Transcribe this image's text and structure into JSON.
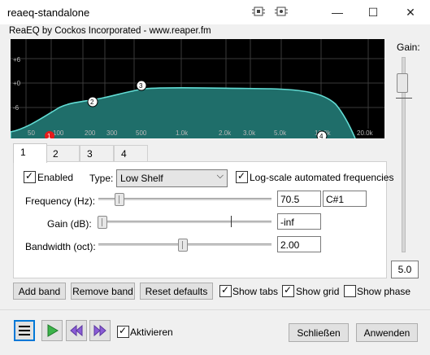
{
  "window": {
    "title": "reaeq-standalone",
    "minimize": "—",
    "maximize": "☐",
    "close": "✕"
  },
  "plugin": {
    "info": "ReaEQ by Cockos Incorporated - www.reaper.fm"
  },
  "graph": {
    "db_labels": [
      "+6",
      "+0",
      "-6"
    ],
    "freq_labels": [
      "50",
      "100",
      "200",
      "300",
      "500",
      "1.0k",
      "2.0k",
      "3.0k",
      "5.0k",
      "10.0k",
      "20.0k"
    ],
    "band_markers": [
      "1",
      "2",
      "3",
      "4"
    ],
    "colors": {
      "background": "#000000",
      "fill": "#1f6e6a",
      "curve": "#62dcd4",
      "grid": "#3a3a3a",
      "label": "#b8b8b8",
      "band1": "#e51b1b"
    }
  },
  "gain": {
    "label": "Gain:",
    "value": "5.0"
  },
  "tabs": [
    "1",
    "2",
    "3",
    "4"
  ],
  "band": {
    "enabled_label": "Enabled",
    "enabled": true,
    "type_label": "Type:",
    "type_value": "Low Shelf",
    "log_scale_label": "Log-scale automated frequencies",
    "log_scale": true,
    "frequency_label": "Frequency (Hz):",
    "frequency_value": "70.5",
    "note_value": "C#1",
    "gain_label": "Gain (dB):",
    "gain_value": "-inf",
    "bandwidth_label": "Bandwidth (oct):",
    "bandwidth_value": "2.00"
  },
  "actions": {
    "add_band": "Add band",
    "remove_band": "Remove band",
    "reset_defaults": "Reset defaults",
    "show_tabs": "Show tabs",
    "show_grid": "Show grid",
    "show_phase": "Show phase"
  },
  "toggles": {
    "show_tabs": true,
    "show_grid": true,
    "show_phase": false
  },
  "footer": {
    "activate_label": "Aktivieren",
    "activate": true,
    "close_button": "Schließen",
    "apply_button": "Anwenden"
  }
}
